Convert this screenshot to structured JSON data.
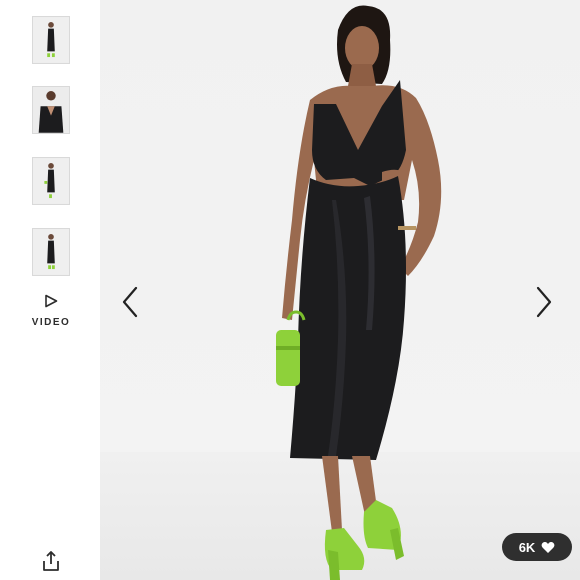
{
  "gallery": {
    "thumbnails": [
      {
        "label": "thumbnail-1"
      },
      {
        "label": "thumbnail-2"
      },
      {
        "label": "thumbnail-3"
      },
      {
        "label": "thumbnail-4"
      }
    ],
    "video_label": "VIDEO",
    "icons": {
      "video": "play-triangle-icon",
      "share": "share-icon",
      "prev": "chevron-left-icon",
      "next": "chevron-right-icon",
      "like": "heart-icon"
    }
  },
  "social": {
    "likes_count": "6K"
  },
  "colors": {
    "dress": "#1c1c1e",
    "accessories": "#8ed13a",
    "badge": "#2f2f2f",
    "background": "#f2f2f2"
  }
}
